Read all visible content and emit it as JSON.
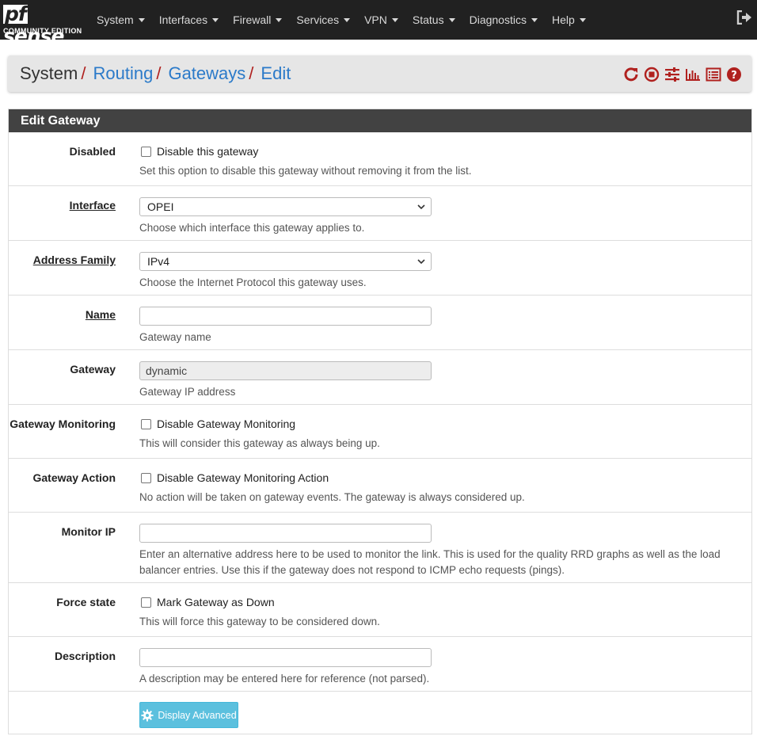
{
  "brand": {
    "logo_pf": "pf",
    "logo_sense": "sense",
    "edition": "COMMUNITY EDITION"
  },
  "nav": {
    "items": [
      {
        "label": "System"
      },
      {
        "label": "Interfaces"
      },
      {
        "label": "Firewall"
      },
      {
        "label": "Services"
      },
      {
        "label": "VPN"
      },
      {
        "label": "Status"
      },
      {
        "label": "Diagnostics"
      },
      {
        "label": "Help"
      }
    ],
    "logout_icon": "sign-out-icon"
  },
  "breadcrumb": {
    "items": [
      "System",
      "Routing",
      "Gateways",
      "Edit"
    ],
    "separator": "/"
  },
  "toolbar": {
    "icons": [
      "reload-icon",
      "stop-icon",
      "sliders-icon",
      "bar-chart-icon",
      "list-icon",
      "help-icon"
    ],
    "icon_color": "#b0211f"
  },
  "panel": {
    "title": "Edit Gateway"
  },
  "form": {
    "disabled": {
      "label": "Disabled",
      "checkbox_label": "Disable this gateway",
      "help": "Set this option to disable this gateway without removing it from the list."
    },
    "interface": {
      "label": "Interface",
      "value": "OPEI",
      "help": "Choose which interface this gateway applies to."
    },
    "address_family": {
      "label": "Address Family",
      "value": "IPv4",
      "help": "Choose the Internet Protocol this gateway uses."
    },
    "name": {
      "label": "Name",
      "value": "",
      "help": "Gateway name"
    },
    "gateway": {
      "label": "Gateway",
      "value": "dynamic",
      "help": "Gateway IP address"
    },
    "gateway_monitoring": {
      "label": "Gateway Monitoring",
      "checkbox_label": "Disable Gateway Monitoring",
      "help": "This will consider this gateway as always being up."
    },
    "gateway_action": {
      "label": "Gateway Action",
      "checkbox_label": "Disable Gateway Monitoring Action",
      "help": "No action will be taken on gateway events. The gateway is always considered up."
    },
    "monitor_ip": {
      "label": "Monitor IP",
      "value": "",
      "help": "Enter an alternative address here to be used to monitor the link. This is used for the quality RRD graphs as well as the load balancer entries. Use this if the gateway does not respond to ICMP echo requests (pings)."
    },
    "force_state": {
      "label": "Force state",
      "checkbox_label": "Mark Gateway as Down",
      "help": "This will force this gateway to be considered down."
    },
    "description": {
      "label": "Description",
      "value": "",
      "help": "A description may be entered here for reference (not parsed)."
    },
    "advanced_button": {
      "label": "Display Advanced",
      "icon": "gear-icon",
      "color": "#5bc0de"
    }
  }
}
